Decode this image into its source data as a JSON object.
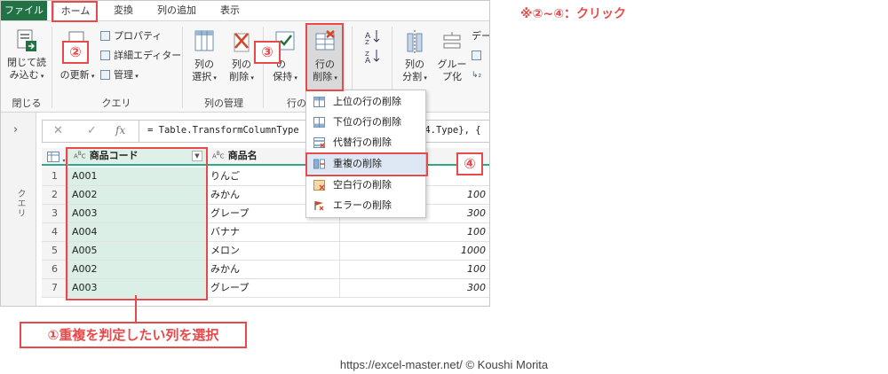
{
  "tabs": {
    "file": "ファイル",
    "home": "ホーム",
    "transform": "変換",
    "add_column": "列の追加",
    "view": "表示"
  },
  "ribbon": {
    "close_load_line1": "閉じて読",
    "close_load_line2": "み込む",
    "refresh_label": "の更新",
    "properties": "プロパティ",
    "advanced_editor": "詳細エディター",
    "manage": "管理",
    "choose_cols_line1": "列の",
    "choose_cols_line2": "選択",
    "remove_cols_line1": "列の",
    "remove_cols_line2": "削除",
    "keep_rows_line1": "の",
    "keep_rows_line2": "保持",
    "remove_rows_line1": "行の",
    "remove_rows_line2": "削除",
    "split_line1": "列の",
    "split_line2": "分割",
    "group_line1": "グルー",
    "group_line2": "プ化",
    "data_type_partial": "デー",
    "groups": {
      "close": "閉じる",
      "query": "クエリ",
      "manage_cols": "列の管理",
      "rows_partial": "行の"
    }
  },
  "query_pane": {
    "label": "クエリ",
    "expand_glyph": "›"
  },
  "formula_bar": {
    "cancel_glyph": "✕",
    "confirm_glyph": "✓",
    "fx": "fx",
    "text": "= Table.TransformColumnType",
    "text_tail": "64.Type}, {"
  },
  "table": {
    "columns": {
      "code": "商品コード",
      "name": "商品名"
    },
    "rows": [
      {
        "index": "1",
        "code": "A001",
        "name": "りんご",
        "amount": ""
      },
      {
        "index": "2",
        "code": "A002",
        "name": "みかん",
        "amount": "100"
      },
      {
        "index": "3",
        "code": "A003",
        "name": "グレープ",
        "amount": "300"
      },
      {
        "index": "4",
        "code": "A004",
        "name": "バナナ",
        "amount": "100"
      },
      {
        "index": "5",
        "code": "A005",
        "name": "メロン",
        "amount": "1000"
      },
      {
        "index": "6",
        "code": "A002",
        "name": "みかん",
        "amount": "100"
      },
      {
        "index": "7",
        "code": "A003",
        "name": "グレープ",
        "amount": "300"
      }
    ]
  },
  "remove_rows_menu": {
    "items": [
      {
        "label": "上位の行の削除"
      },
      {
        "label": "下位の行の削除"
      },
      {
        "label": "代替行の削除"
      },
      {
        "label": "重複の削除"
      },
      {
        "label": "空白行の削除"
      },
      {
        "label": "エラーの削除"
      }
    ]
  },
  "annotations": {
    "note": "※②~④：クリック",
    "step1": "①重複を判定したい列を選択",
    "step2": "②",
    "step3": "③",
    "step4": "④"
  },
  "footer": {
    "credit": "https://excel-master.net/  © Koushi Morita"
  },
  "colors": {
    "accent_green": "#217346",
    "selected_column": "#dcefe6",
    "annotation_red": "#e64a4a",
    "header_underline": "#2ea88a"
  }
}
